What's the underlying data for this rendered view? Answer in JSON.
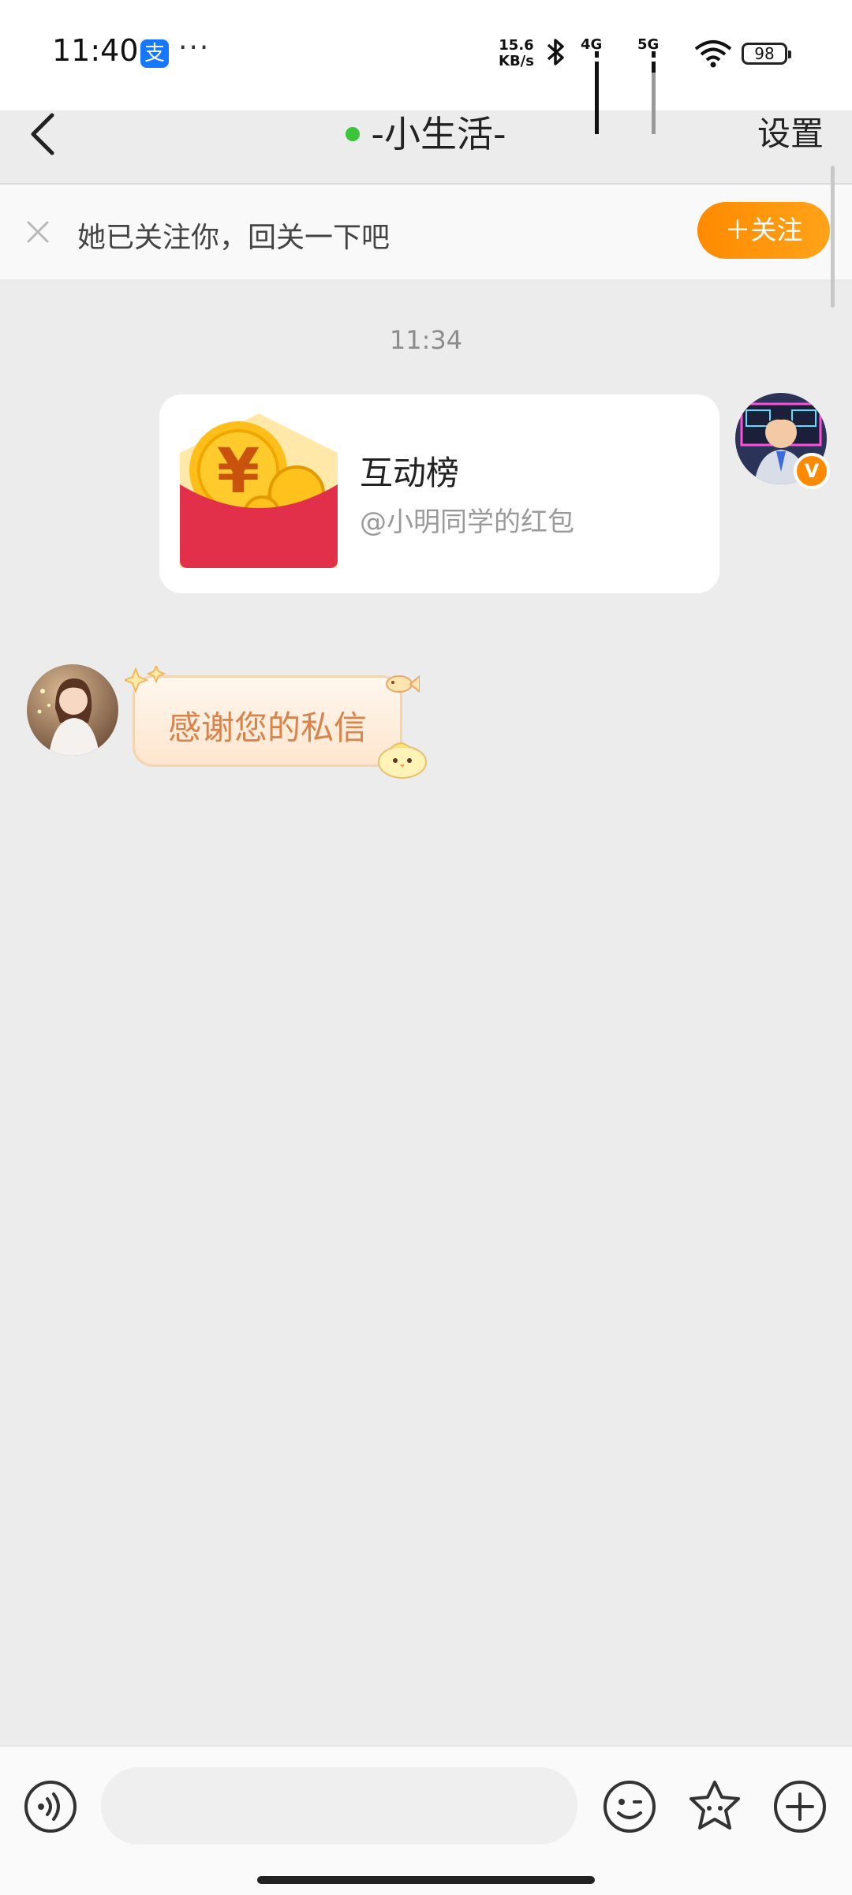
{
  "status_bar": {
    "time": "11:40",
    "alipay_label": "支",
    "more_dots": "···",
    "net_speed_value": "15.6",
    "net_speed_unit": "KB/s",
    "sim1_gen": "4G",
    "sim2_gen": "5G",
    "battery": "98"
  },
  "nav": {
    "title": "-小生活-",
    "online_color": "#3cc43a",
    "settings": "设置"
  },
  "follow_banner": {
    "text": "她已关注你，回关一下吧",
    "button": "＋关注",
    "button_color": "#ff8a00"
  },
  "chat": {
    "timestamp": "11:34",
    "messages": [
      {
        "from": "me",
        "type": "card",
        "title": "互动榜",
        "subtitle": "@小明同学的红包",
        "verified_badge": "V"
      },
      {
        "from": "her",
        "type": "text",
        "text": "感谢您的私信"
      }
    ]
  },
  "input_bar": {
    "icons": [
      "voice-icon",
      "emoji-icon",
      "sticker-icon",
      "plus-icon"
    ],
    "placeholder": ""
  }
}
